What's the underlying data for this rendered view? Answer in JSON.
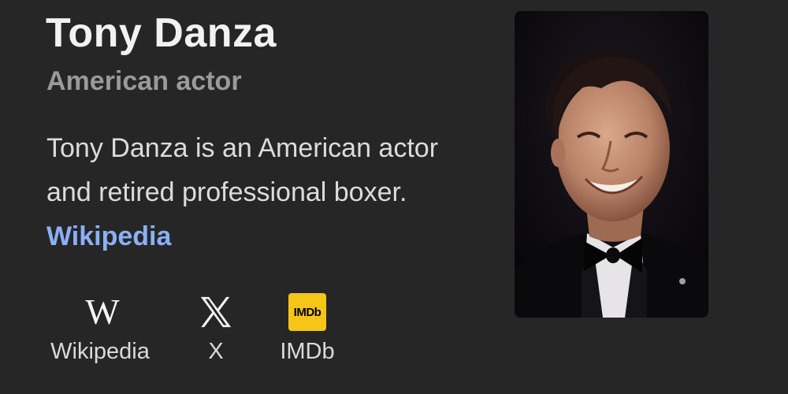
{
  "entity": {
    "name": "Tony Danza",
    "subtitle": "American actor",
    "description_text": "Tony Danza is an American actor and retired professional boxer.",
    "description_source_link": "Wikipedia"
  },
  "profiles": [
    {
      "label": "Wikipedia",
      "icon": "wikipedia-icon",
      "glyph": "W"
    },
    {
      "label": "X",
      "icon": "x-icon"
    },
    {
      "label": "IMDb",
      "icon": "imdb-icon",
      "badge_text": "IMDb"
    }
  ],
  "colors": {
    "background": "#262626",
    "link": "#8ab0f8",
    "imdb_yellow": "#f5c518"
  }
}
